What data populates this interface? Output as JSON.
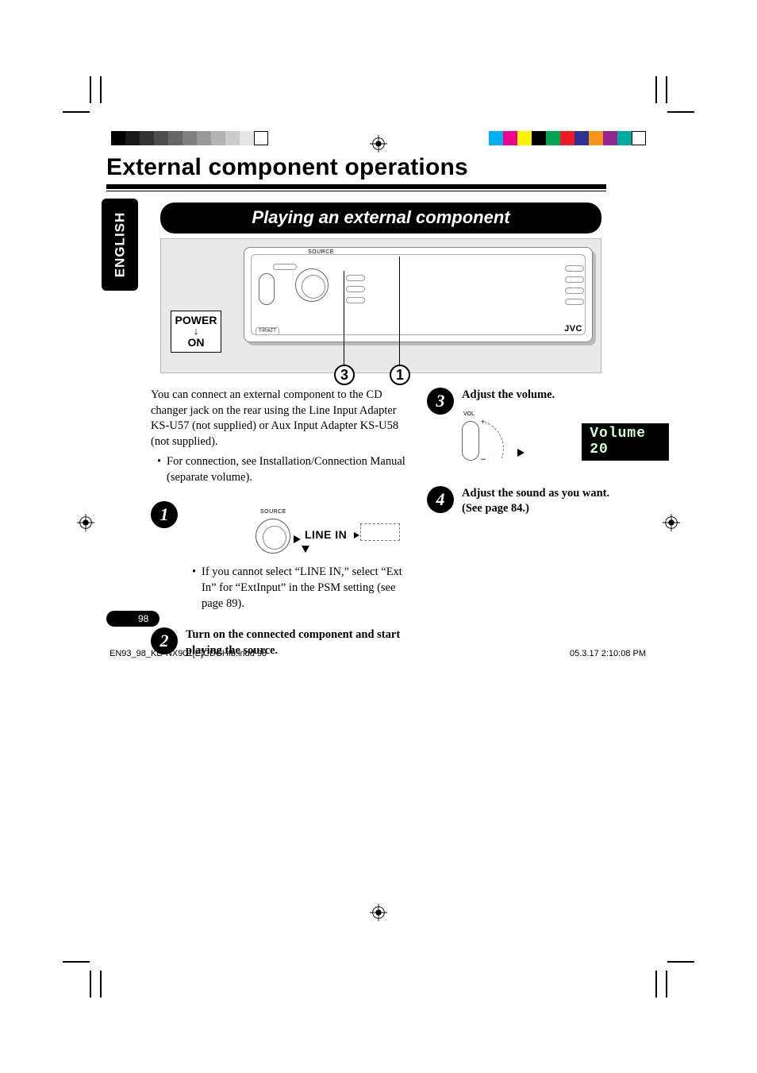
{
  "language_tab": "ENGLISH",
  "title": "External component operations",
  "section_heading": "Playing an external component",
  "stereo": {
    "source_label": "SOURCE",
    "brand": "JVC",
    "reset_label": "T/P/ATT"
  },
  "power_label": {
    "line1": "POWER",
    "line2": "ON"
  },
  "callout_3_num": "3",
  "callout_1_num": "1",
  "intro": "You can connect an external component to the CD changer jack on the rear using the Line Input Adapter KS-U57 (not supplied) or Aux Input Adapter KS-U58 (not supplied).",
  "intro_bullet": "For connection, see Installation/Connection Manual (separate volume).",
  "step1": {
    "num": "1",
    "source_label": "SOURCE",
    "line_in_label": "LINE IN",
    "bullet": "If you cannot select “LINE IN,” select “Ext In” for “ExtInput” in the PSM setting (see page 89)."
  },
  "step2": {
    "num": "2",
    "text": "Turn on the connected component and start playing the source."
  },
  "step3": {
    "num": "3",
    "heading": "Adjust the volume.",
    "vol_label": "VOL",
    "display": "Volume 20"
  },
  "step4": {
    "num": "4",
    "line1": "Adjust the sound as you want.",
    "line2": "(See page 84.)"
  },
  "page_number": "98",
  "footer_left": "EN93_98_KD-NX901[E]CDCHfb.indd   98",
  "footer_right": "05.3.17   2:10:08 PM",
  "color_bars_left": [
    "#000",
    "#1a1a1a",
    "#333",
    "#4d4d4d",
    "#666",
    "#808080",
    "#999",
    "#b3b3b3",
    "#ccc",
    "#e6e6e6",
    "#fff"
  ],
  "color_bars_right": [
    "#00aeef",
    "#ec008c",
    "#fff200",
    "#000000",
    "#00a651",
    "#ed1c24",
    "#2e3192",
    "#f7941d",
    "#92278f",
    "#00a99d",
    "#fff"
  ]
}
